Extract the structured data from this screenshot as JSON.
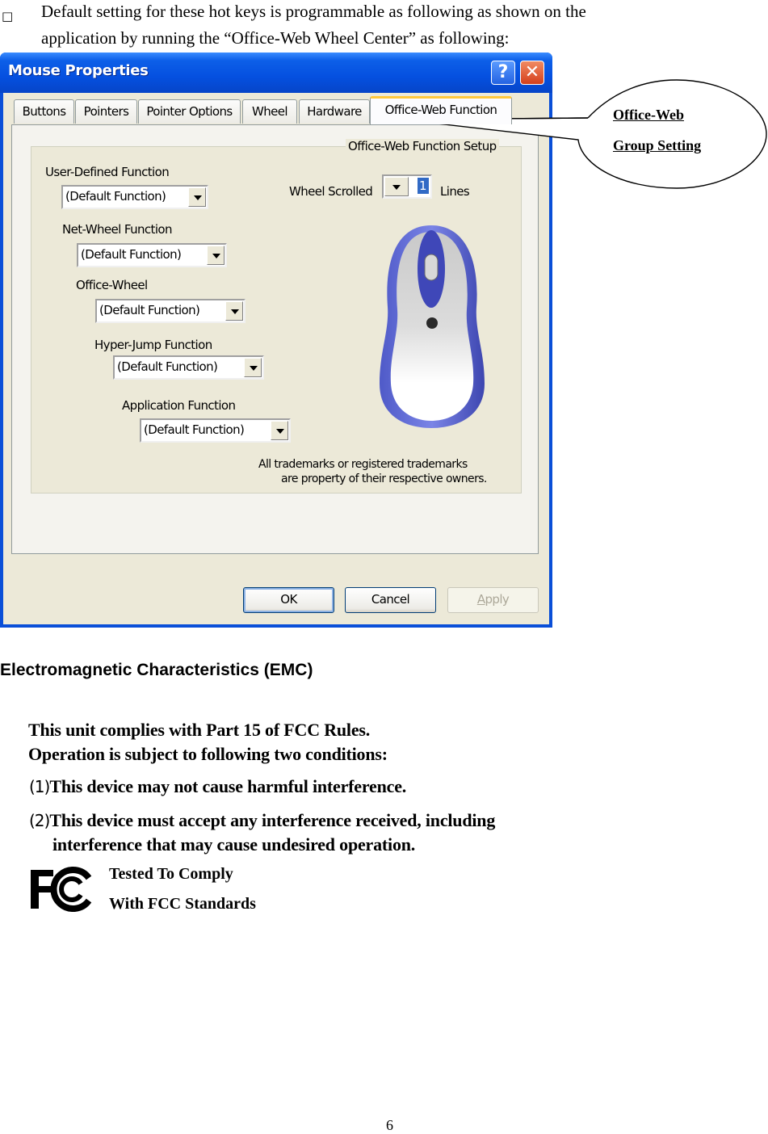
{
  "intro": {
    "bullet": "□",
    "line1": "Default setting for these hot keys is programmable as following as shown on the",
    "line2": "application by running the “Office-Web Wheel Center” as following:"
  },
  "window": {
    "title": "Mouse Properties",
    "help_label": "?",
    "close_label": "✕",
    "tabs": [
      {
        "label": "Buttons",
        "active": false
      },
      {
        "label": "Pointers",
        "active": false
      },
      {
        "label": "Pointer Options",
        "active": false
      },
      {
        "label": "Wheel",
        "active": false
      },
      {
        "label": "Hardware",
        "active": false
      },
      {
        "label": "Office-Web Function",
        "active": true
      }
    ],
    "group_title": "Office-Web Function Setup",
    "functions": [
      {
        "label": "User-Defined Function",
        "value": "(Default Function)"
      },
      {
        "label": "Net-Wheel Function",
        "value": "(Default Function)"
      },
      {
        "label": "Office-Wheel",
        "value": "(Default Function)"
      },
      {
        "label": "Hyper-Jump Function",
        "value": "(Default Function)"
      },
      {
        "label": "Application Function",
        "value": "(Default Function)"
      }
    ],
    "wheel_scrolled": {
      "label": "Wheel Scrolled",
      "value": "1",
      "unit": "Lines"
    },
    "mouse_image": "mouse-icon",
    "trademark_line1": "All trademarks or registered trademarks",
    "trademark_line2": "are property of their respective owners.",
    "buttons": {
      "ok": "OK",
      "cancel": "Cancel",
      "apply_accel": "A",
      "apply_rest": "pply"
    }
  },
  "callout": {
    "line1": "Office-Web",
    "line2": "Group Setting"
  },
  "emc": {
    "title": "Electromagnetic Characteristics (EMC)",
    "line1": "This unit complies with Part 15 of FCC Rules.",
    "line2": "Operation is subject to following two conditions:",
    "cond1_num": "(1)",
    "cond1": "This device may not cause harmful interference.",
    "cond2_num": "(2)",
    "cond2": "This device must accept any interference received, including",
    "cond2_cont": "interference that may cause undesired operation.",
    "fcc_logo": "fcc-logo-icon",
    "tested1": "Tested To Comply",
    "tested2": "With FCC Standards"
  },
  "page_number": "6"
}
